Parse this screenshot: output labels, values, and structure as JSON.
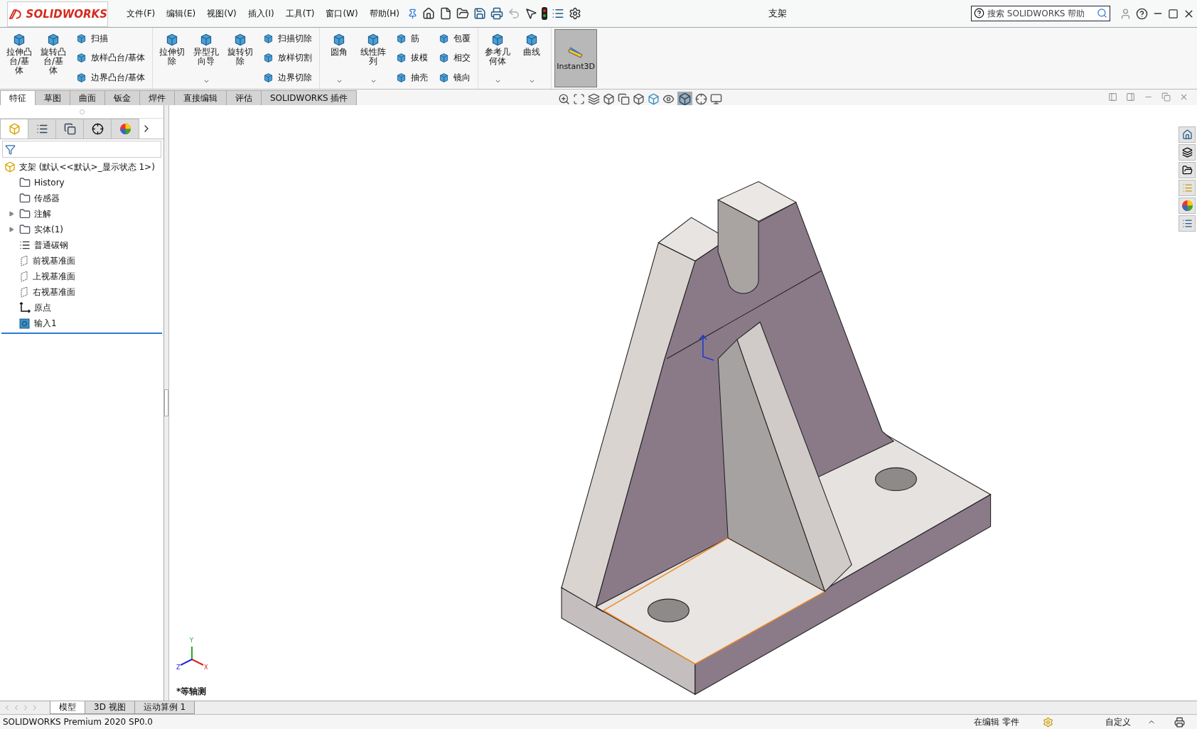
{
  "app": {
    "logo": "SOLIDWORKS"
  },
  "menu": [
    "文件(F)",
    "编辑(E)",
    "视图(V)",
    "插入(I)",
    "工具(T)",
    "窗口(W)",
    "帮助(H)"
  ],
  "window": {
    "title": "支架"
  },
  "search": {
    "placeholder": "搜索 SOLIDWORKS 帮助"
  },
  "ribbon": [
    {
      "commands": [
        {
          "kind": "large",
          "label": "拉伸凸台/基体"
        },
        {
          "kind": "large",
          "label": "旋转凸台/基体"
        },
        {
          "kind": "stack",
          "items": [
            "扫描",
            "放样凸台/基体",
            "边界凸台/基体"
          ]
        }
      ]
    },
    {
      "commands": [
        {
          "kind": "large",
          "label": "拉伸切除"
        },
        {
          "kind": "large",
          "label": "异型孔向导",
          "dropdown": true
        },
        {
          "kind": "large",
          "label": "旋转切除"
        },
        {
          "kind": "stack",
          "items": [
            "扫描切除",
            "放样切割",
            "边界切除"
          ]
        }
      ]
    },
    {
      "commands": [
        {
          "kind": "large",
          "label": "圆角",
          "dropdown": true
        },
        {
          "kind": "large",
          "label": "线性阵列",
          "dropdown": true
        },
        {
          "kind": "stack",
          "items": [
            "筋",
            "拔模",
            "抽壳"
          ]
        },
        {
          "kind": "stack",
          "items": [
            "包覆",
            "相交",
            "镜向"
          ]
        }
      ]
    },
    {
      "commands": [
        {
          "kind": "large",
          "label": "参考几何体",
          "dropdown": true
        },
        {
          "kind": "large",
          "label": "曲线",
          "dropdown": true
        }
      ]
    }
  ],
  "instant3d": {
    "label": "Instant3D",
    "selected": true
  },
  "command_tabs": [
    {
      "label": "特征",
      "selected": true
    },
    {
      "label": "草图",
      "selected": false
    },
    {
      "label": "曲面",
      "selected": false
    },
    {
      "label": "钣金",
      "selected": false
    },
    {
      "label": "焊件",
      "selected": false
    },
    {
      "label": "直接编辑",
      "selected": false
    },
    {
      "label": "评估",
      "selected": false
    },
    {
      "label": "SOLIDWORKS 插件",
      "selected": false
    }
  ],
  "manager_tabs": [
    {
      "kind": "feature",
      "selected": true
    },
    {
      "kind": "property",
      "selected": false
    },
    {
      "kind": "config",
      "selected": false
    },
    {
      "kind": "dimxpert",
      "selected": false
    },
    {
      "kind": "display",
      "selected": false
    }
  ],
  "feature_tree": {
    "root": "支架  (默认<<默认>_显示状态 1>)",
    "items": [
      {
        "kind": "history",
        "label": "History"
      },
      {
        "kind": "sensor",
        "label": "传感器"
      },
      {
        "kind": "annotation",
        "label": "注解",
        "expanded": false
      },
      {
        "kind": "body",
        "label": "实体(1)",
        "expanded": false
      },
      {
        "kind": "material",
        "label": "普通碳钢"
      },
      {
        "kind": "plane",
        "label": "前视基准面"
      },
      {
        "kind": "plane",
        "label": "上视基准面"
      },
      {
        "kind": "plane",
        "label": "右视基准面"
      },
      {
        "kind": "origin",
        "label": "原点"
      },
      {
        "kind": "import",
        "label": "输入1"
      }
    ]
  },
  "viewport": {
    "view_name": "*等轴测",
    "triad": {
      "x": "X",
      "y": "Y",
      "z": "Z"
    }
  },
  "model_tabs": [
    {
      "label": "模型",
      "selected": true
    },
    {
      "label": "3D 视图",
      "selected": false
    },
    {
      "label": "运动算例 1",
      "selected": false
    }
  ],
  "status_bar": {
    "product": "SOLIDWORKS Premium 2020 SP0.0",
    "mode": "在编辑 零件",
    "units": "自定义"
  }
}
